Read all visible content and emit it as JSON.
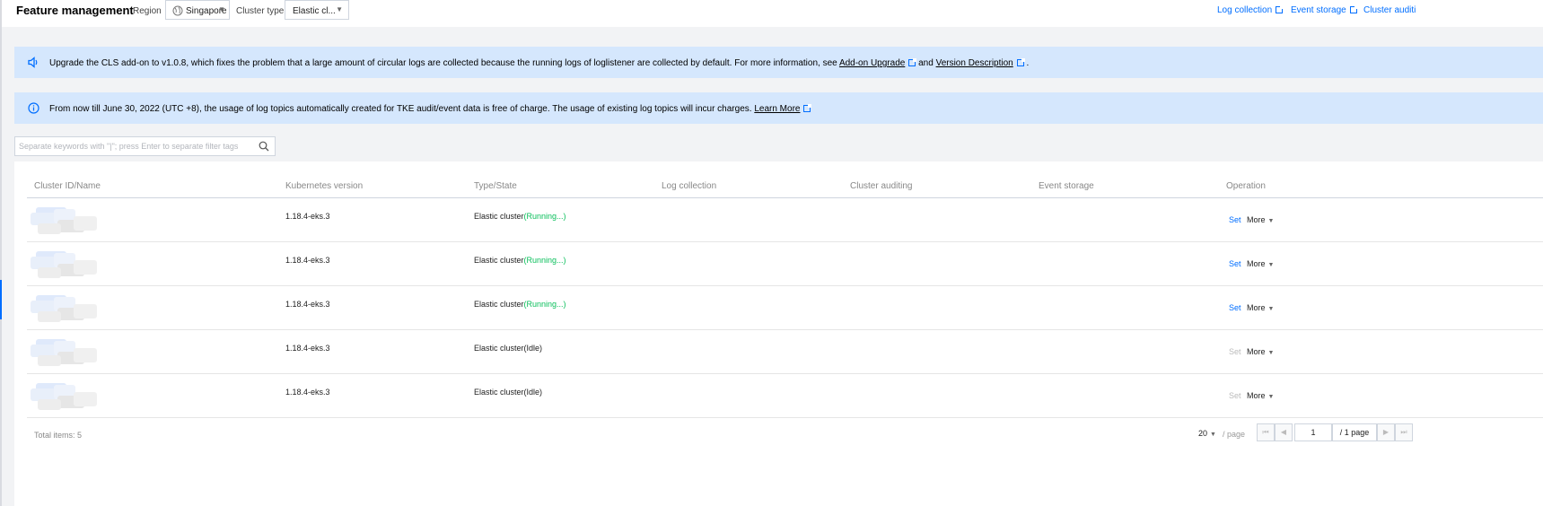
{
  "header": {
    "title": "Feature management",
    "region_label": "Region",
    "region_value": "Singapore",
    "cluster_type_label": "Cluster type",
    "cluster_type_value": "Elastic cl...",
    "links": [
      "Log collection",
      "Event storage",
      "Cluster auditi"
    ]
  },
  "banners": [
    {
      "icon": "speaker-icon",
      "text": "Upgrade the CLS add-on to v1.0.8, which fixes the problem that a large amount of circular logs are collected because the running logs of loglistener are collected by default. For more information, see ",
      "link1": "Add-on Upgrade",
      "mid": "and",
      "link2": "Version Description",
      "end": "."
    },
    {
      "icon": "info-icon",
      "text": "From now till June 30, 2022 (UTC +8), the usage of log topics automatically created for TKE audit/event data is free of charge. The usage of existing log topics will incur charges.",
      "link": "Learn More"
    }
  ],
  "search": {
    "placeholder": "Separate keywords with \"|\"; press Enter to separate filter tags"
  },
  "table": {
    "columns": [
      "Cluster ID/Name",
      "Kubernetes version",
      "Type/State",
      "Log collection",
      "Cluster auditing",
      "Event storage",
      "Operation"
    ],
    "rows": [
      {
        "version": "1.18.4-eks.3",
        "type": "Elastic cluster",
        "state": "(Running...)",
        "state_kind": "running",
        "set": "Set",
        "set_enabled": true,
        "more": "More"
      },
      {
        "version": "1.18.4-eks.3",
        "type": "Elastic cluster",
        "state": "(Running...)",
        "state_kind": "running",
        "set": "Set",
        "set_enabled": true,
        "more": "More"
      },
      {
        "version": "1.18.4-eks.3",
        "type": "Elastic cluster",
        "state": "(Running...)",
        "state_kind": "running",
        "set": "Set",
        "set_enabled": true,
        "more": "More"
      },
      {
        "version": "1.18.4-eks.3",
        "type": "Elastic cluster",
        "state": "(Idle)",
        "state_kind": "idle",
        "set": "Set",
        "set_enabled": false,
        "more": "More"
      },
      {
        "version": "1.18.4-eks.3",
        "type": "Elastic cluster",
        "state": "(Idle)",
        "state_kind": "idle",
        "set": "Set",
        "set_enabled": false,
        "more": "More"
      }
    ]
  },
  "footer": {
    "total": "Total items:  5",
    "page_size": "20",
    "per_page": "/ page",
    "page": "1",
    "page_total": "/ 1 page"
  },
  "colors": {
    "accent": "#006eff",
    "running": "#0abf5b",
    "banner_bg": "#d5e7fd"
  }
}
